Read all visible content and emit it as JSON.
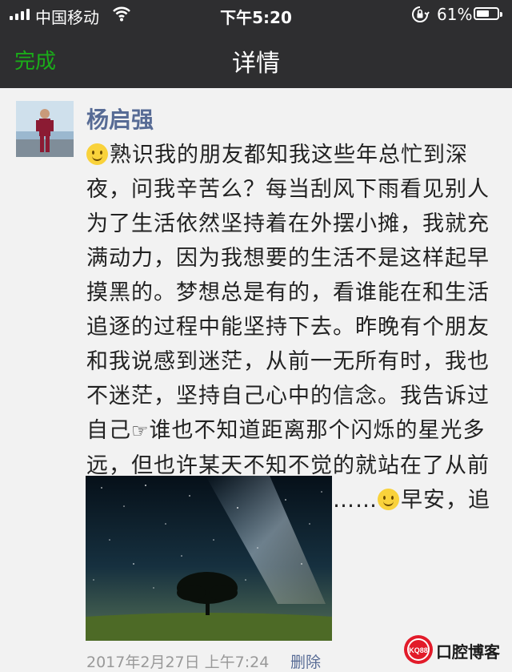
{
  "status_bar": {
    "carrier": "中国移动",
    "time": "下午5:20",
    "battery_percent": "61%",
    "battery_level": 0.61,
    "icons": [
      "signal-icon",
      "wifi-icon",
      "orientation-lock-icon",
      "battery-icon"
    ]
  },
  "nav": {
    "done_label": "完成",
    "title": "详情",
    "accent_color": "#1aad19",
    "background_color": "#2e2e30"
  },
  "post": {
    "author": "杨启强",
    "text_parts": [
      "熟识我的朋友都知我这些年总忙到深夜，问我辛苦么？每当刮风下雨看见别人为了生活依然坚持着在外摆小摊，我就充满动力，因为我想要的生活不是这样起早摸黑的。梦想总是有的，看谁能在和生活追逐的过程中能坚持下去。昨晚有个朋友和我说感到迷茫，从前一无所有时，我也不迷茫，坚持自己心中的信念。我告诉过自己",
      "☞",
      "谁也不知道距离那个闪烁的星光多远，但也许某天不知不觉的就站在了从前不敢想也不曾想过的位置……",
      "早安，追梦，说给迷茫的人听"
    ],
    "time": "2017年2月27日 上午7:24",
    "delete_label": "删除",
    "name_color": "#576b95"
  },
  "watermark": {
    "badge": "KQ88",
    "text": "口腔博客"
  }
}
